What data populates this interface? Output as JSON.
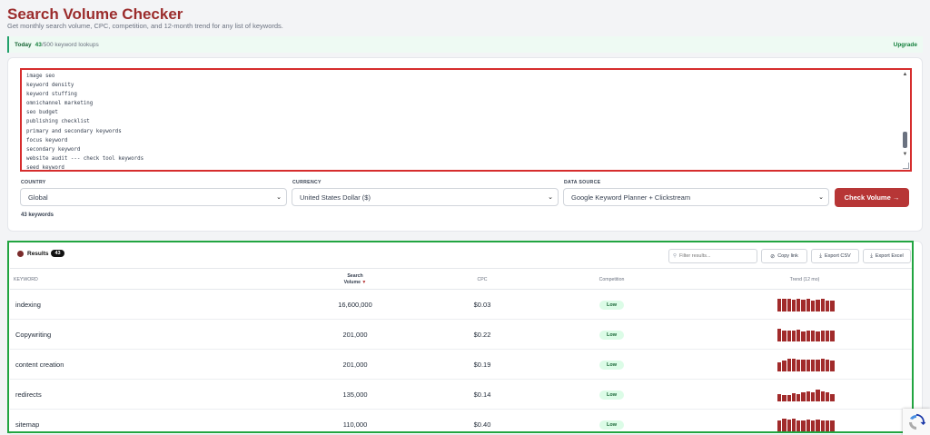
{
  "page": {
    "title": "Search Volume Checker",
    "subtitle": "Get monthly search volume, CPC, competition, and 12-month trend for any list of keywords."
  },
  "usage": {
    "today_label": "Today",
    "count": "43",
    "rest": "/500 keyword lookups",
    "upgrade_label": "Upgrade"
  },
  "keywords_input": {
    "lines": [
      "image seo",
      "keyword density",
      "keyword stuffing",
      "omnichannel marketing",
      "seo budget",
      "publishing checklist",
      "primary and secondary keywords",
      "focus keyword",
      "secondary keyword",
      "website audit --- check tool keywords",
      "seed keyword"
    ]
  },
  "filters": {
    "country": {
      "label": "COUNTRY",
      "value": "Global"
    },
    "currency": {
      "label": "CURRENCY",
      "value": "United States Dollar ($)"
    },
    "data_source": {
      "label": "DATA SOURCE",
      "value": "Google Keyword Planner + Clickstream"
    },
    "check_button": "Check Volume →",
    "keyword_count": "43 keywords"
  },
  "results": {
    "title": "Results",
    "count": "43",
    "filter_placeholder": "Filter results...",
    "copy_link": "Copy link",
    "export_csv": "Export CSV",
    "export_excel": "Export Excel",
    "columns": {
      "keyword": "KEYWORD",
      "search_volume_1": "Search",
      "search_volume_2": "Volume",
      "sort_indicator": "▼",
      "cpc": "CPC",
      "competition": "Competition",
      "trend": "Trend (12 mo)"
    },
    "rows": [
      {
        "keyword": "indexing",
        "volume": "16,600,000",
        "cpc": "$0.03",
        "competition": "Low",
        "trend": [
          0.95,
          0.95,
          0.95,
          0.9,
          0.95,
          0.9,
          0.95,
          0.85,
          0.9,
          0.95,
          0.85,
          0.85
        ]
      },
      {
        "keyword": "Copywriting",
        "volume": "201,000",
        "cpc": "$0.22",
        "competition": "Low",
        "trend": [
          0.95,
          0.85,
          0.85,
          0.8,
          0.9,
          0.75,
          0.85,
          0.8,
          0.75,
          0.8,
          0.8,
          0.8
        ]
      },
      {
        "keyword": "content creation",
        "volume": "201,000",
        "cpc": "$0.19",
        "competition": "Low",
        "trend": [
          0.7,
          0.85,
          0.95,
          0.95,
          0.9,
          0.9,
          0.9,
          0.9,
          0.9,
          0.95,
          0.9,
          0.85
        ]
      },
      {
        "keyword": "redirects",
        "volume": "135,000",
        "cpc": "$0.14",
        "competition": "Low",
        "trend": [
          0.55,
          0.45,
          0.5,
          0.6,
          0.55,
          0.7,
          0.75,
          0.7,
          0.9,
          0.75,
          0.7,
          0.55
        ]
      },
      {
        "keyword": "sitemap",
        "volume": "110,000",
        "cpc": "$0.40",
        "competition": "Low",
        "trend": [
          0.85,
          0.95,
          0.9,
          0.95,
          0.85,
          0.8,
          0.9,
          0.85,
          0.9,
          0.85,
          0.8,
          0.85
        ]
      }
    ]
  },
  "colors": {
    "brand": "#9b2c2c",
    "button": "#b73636",
    "trend_bar": "#a12b2b",
    "low_pill_bg": "#dcfce7",
    "input_highlight": "#d62d2d",
    "results_highlight": "#22a541"
  }
}
